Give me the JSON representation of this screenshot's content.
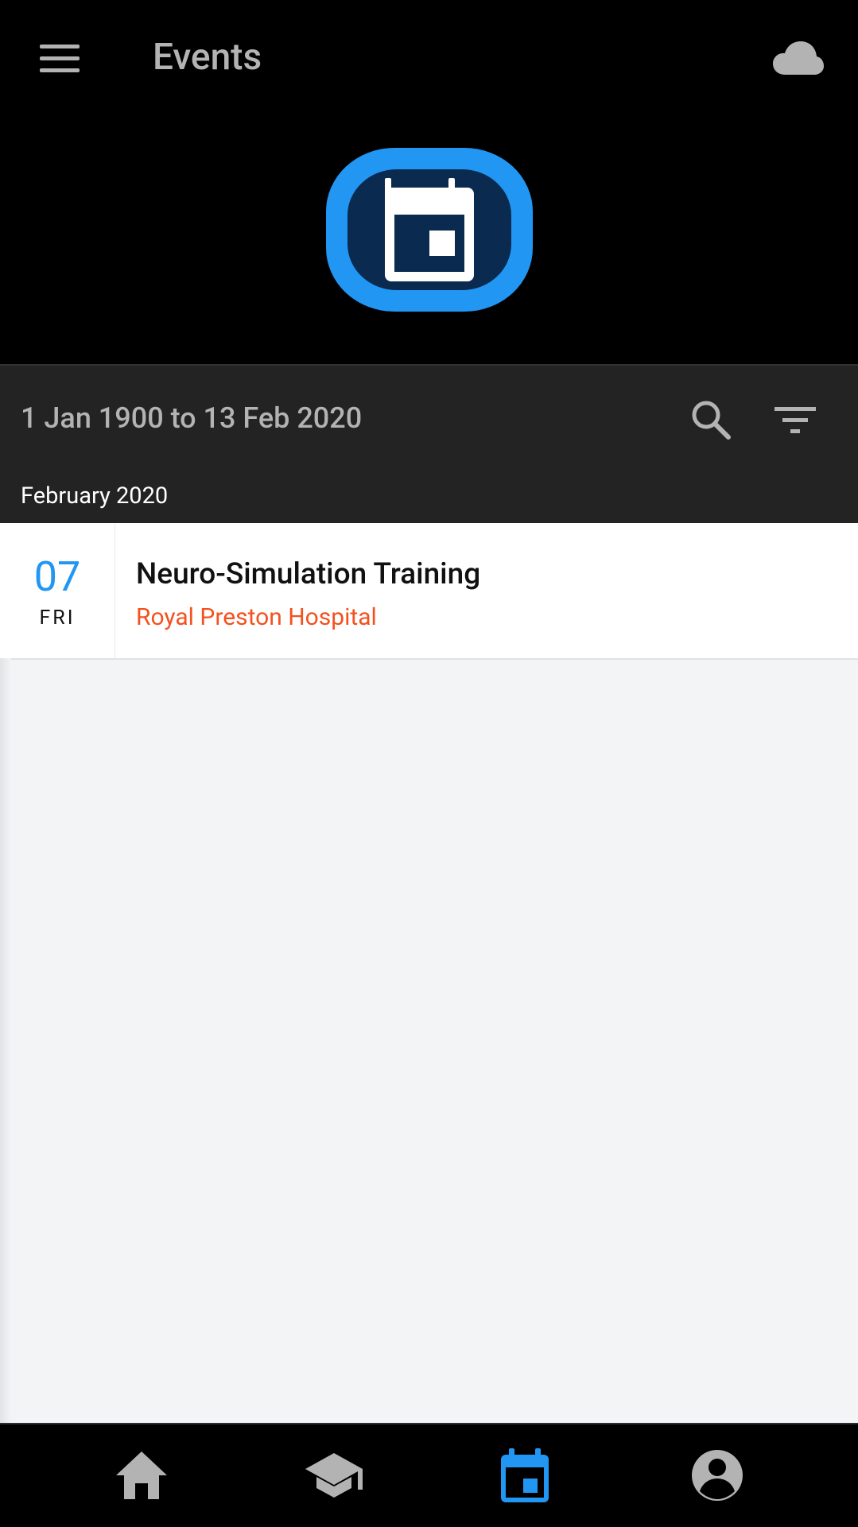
{
  "app_bar": {
    "title": "Events",
    "icons": {
      "menu": "menu-icon",
      "cloud": "cloud-icon",
      "hero": "calendar-icon"
    },
    "colors": {
      "background": "#000000",
      "title": "#b3b3b3",
      "hero_accent": "#2196f3",
      "hero_inner": "#0b2a4f"
    }
  },
  "filter_bar": {
    "date_range": "1 Jan 1900 to 13 Feb 2020",
    "icons": {
      "search": "search-icon",
      "filter": "filter-icon"
    }
  },
  "month_header": {
    "label": "February 2020"
  },
  "events": [
    {
      "day": "07",
      "weekday": "FRI",
      "title": "Neuro-Simulation Training",
      "location": "Royal Preston Hospital",
      "colors": {
        "day": "#2196f3",
        "location": "#f4511e"
      }
    }
  ],
  "bottom_nav": {
    "items": [
      {
        "icon": "home-icon",
        "active": false
      },
      {
        "icon": "graduation-cap-icon",
        "active": false
      },
      {
        "icon": "calendar-icon",
        "active": true
      },
      {
        "icon": "account-circle-icon",
        "active": false
      }
    ],
    "colors": {
      "active": "#2196f3",
      "inactive": "#b3b3b3"
    }
  }
}
